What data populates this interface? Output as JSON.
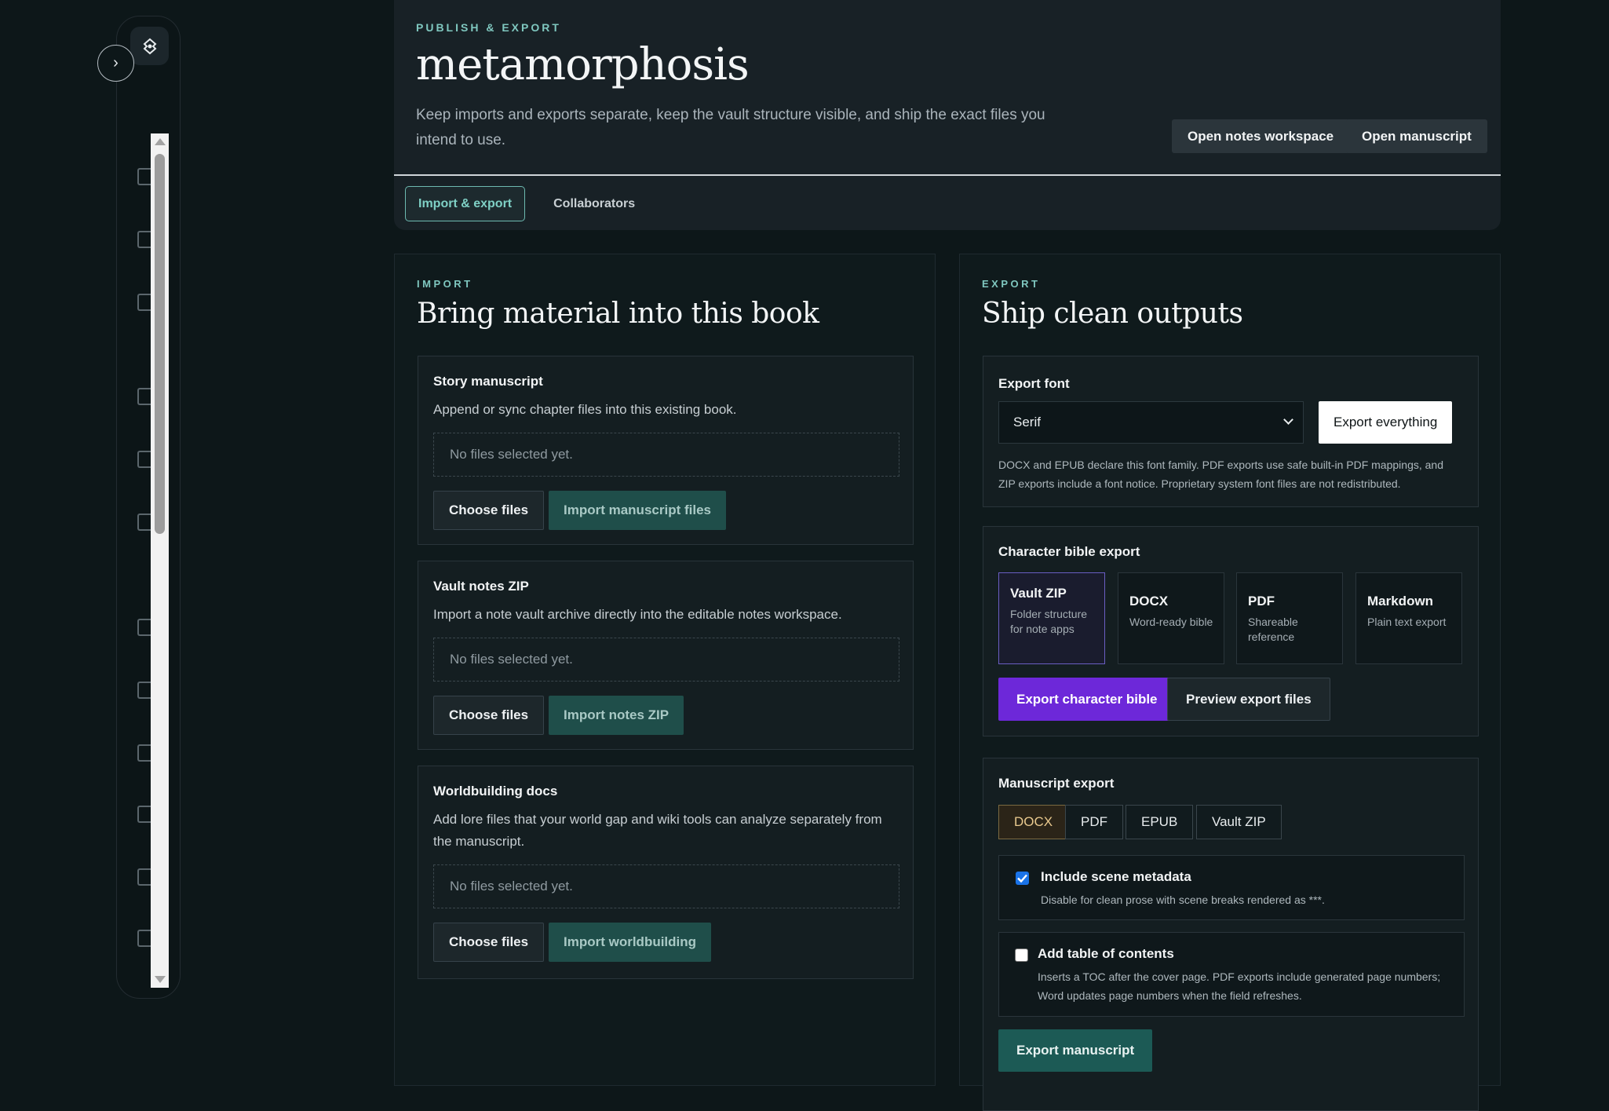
{
  "header": {
    "eyebrow": "PUBLISH & EXPORT",
    "title": "metamorphosis",
    "subtitle": "Keep imports and exports separate, keep the vault structure visible, and ship the exact files you intend to use.",
    "open_notes_label": "Open notes workspace",
    "open_manuscript_label": "Open manuscript",
    "tabs": [
      {
        "label": "Import & export",
        "active": true
      },
      {
        "label": "Collaborators",
        "active": false
      }
    ]
  },
  "import": {
    "eyebrow": "IMPORT",
    "title": "Bring material into this book",
    "cards": [
      {
        "title": "Story manuscript",
        "desc": "Append or sync chapter files into this existing book.",
        "placeholder": "No files selected yet.",
        "choose_label": "Choose files",
        "import_label": "Import manuscript files"
      },
      {
        "title": "Vault notes ZIP",
        "desc": "Import a note vault archive directly into the editable notes workspace.",
        "placeholder": "No files selected yet.",
        "choose_label": "Choose files",
        "import_label": "Import notes ZIP"
      },
      {
        "title": "Worldbuilding docs",
        "desc": "Add lore files that your world gap and wiki tools can analyze separately from the manuscript.",
        "placeholder": "No files selected yet.",
        "choose_label": "Choose files",
        "import_label": "Import worldbuilding"
      }
    ]
  },
  "export": {
    "eyebrow": "EXPORT",
    "title": "Ship clean outputs",
    "font": {
      "label": "Export font",
      "selected": "Serif",
      "export_all_label": "Export everything",
      "note": "DOCX and EPUB declare this font family. PDF exports use safe built-in PDF mappings, and ZIP exports include a font notice. Proprietary system font files are not redistributed."
    },
    "bible": {
      "label": "Character bible export",
      "formats": [
        {
          "name": "Vault ZIP",
          "desc": "Folder structure for note apps",
          "active": true
        },
        {
          "name": "DOCX",
          "desc": "Word-ready bible",
          "active": false
        },
        {
          "name": "PDF",
          "desc": "Shareable reference",
          "active": false
        },
        {
          "name": "Markdown",
          "desc": "Plain text export",
          "active": false
        }
      ],
      "export_label": "Export character bible",
      "preview_label": "Preview export files"
    },
    "manuscript": {
      "label": "Manuscript export",
      "formats": [
        {
          "name": "DOCX",
          "active": true
        },
        {
          "name": "PDF",
          "active": false
        },
        {
          "name": "EPUB",
          "active": false
        },
        {
          "name": "Vault ZIP",
          "active": false
        }
      ],
      "options": [
        {
          "title": "Include scene metadata",
          "desc": "Disable for clean prose with scene breaks rendered as ***.",
          "checked": true
        },
        {
          "title": "Add table of contents",
          "desc": "Inserts a TOC after the cover page. PDF exports include generated page numbers; Word updates page numbers when the field refreshes.",
          "checked": false
        }
      ],
      "export_label": "Export manuscript"
    }
  },
  "icons": {
    "expand": "chevron-right-icon",
    "logo": "app-logo-icon"
  }
}
